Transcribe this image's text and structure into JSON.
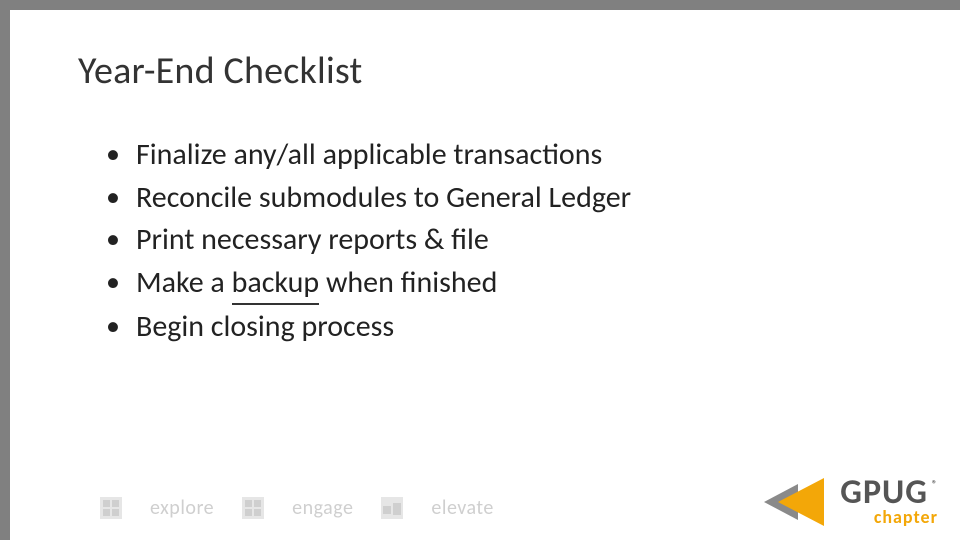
{
  "title": "Year-End Checklist",
  "bullets": {
    "b0": "Finalize any/all applicable transactions",
    "b1": "Reconcile submodules to General Ledger",
    "b2": "Print necessary reports & file",
    "b3_pre": "Make a ",
    "b3_u": "backup",
    "b3_post": " when finished",
    "b4": "Begin closing process"
  },
  "footer": {
    "w1": "explore",
    "w2": "engage",
    "w3": "elevate"
  },
  "logo": {
    "main": "GPUG",
    "reg": "®",
    "sub": "chapter"
  }
}
